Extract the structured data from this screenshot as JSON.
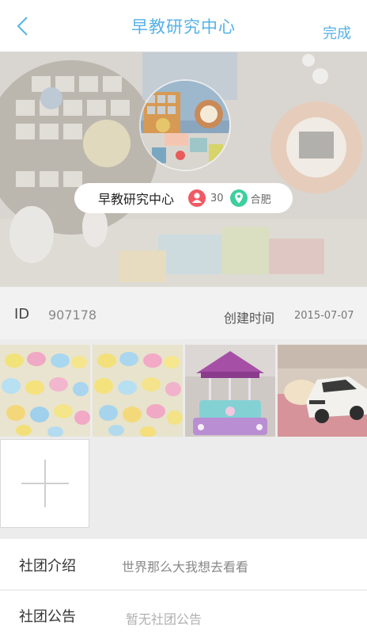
{
  "header": {
    "title": "早教研究中心",
    "done_label": "完成"
  },
  "cover": {
    "org_name": "早教研究中心",
    "member_count": "30",
    "city": "合肥",
    "icons": [
      "people-icon",
      "location-pin-icon"
    ],
    "colors": {
      "member_icon": "#f05a64",
      "location_icon": "#3fcf9e"
    }
  },
  "info": {
    "id_label": "ID",
    "id_value": "907178",
    "created_label": "创建时间",
    "created_value": "2015-07-07"
  },
  "photos": {
    "items": [
      "cookies-photo-1",
      "cookies-photo-2",
      "carousel-cake-photo",
      "car-cake-photo"
    ],
    "add_icon": "plus-icon"
  },
  "rows": {
    "intro_label": "社团介绍",
    "intro_value": "世界那么大我想去看看",
    "notice_label": "社团公告",
    "notice_value": "暂无社团公告"
  },
  "theme": {
    "accent": "#55b2e6"
  }
}
